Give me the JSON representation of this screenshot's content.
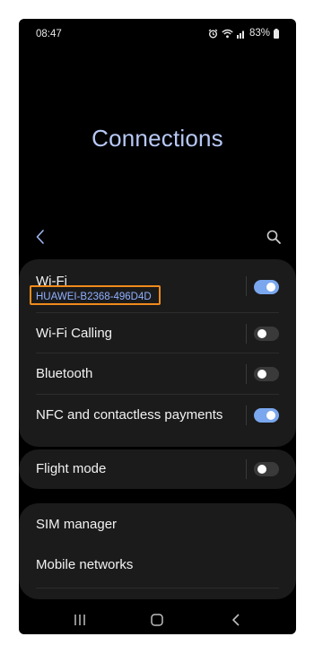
{
  "status": {
    "time": "08:47",
    "battery": "83%",
    "icons": [
      "alarm-icon",
      "wifi-icon",
      "signal-icon",
      "battery-icon"
    ]
  },
  "header": {
    "title": "Connections"
  },
  "sections": {
    "wifi": {
      "label": "Wi-Fi",
      "network": "HUAWEI-B2368-496D4D",
      "enabled": true
    },
    "wifi_calling": {
      "label": "Wi-Fi Calling",
      "enabled": false
    },
    "bluetooth": {
      "label": "Bluetooth",
      "enabled": false
    },
    "nfc": {
      "label": "NFC and contactless payments",
      "enabled": true
    },
    "flight_mode": {
      "label": "Flight mode",
      "enabled": false
    },
    "sim_manager": {
      "label": "SIM manager"
    },
    "mobile_networks": {
      "label": "Mobile networks"
    }
  },
  "colors": {
    "accent": "#7aa7ee",
    "title": "#b7c8f5",
    "highlight": "#f08a1c",
    "card": "#1b1b1b"
  },
  "nav": {
    "icons": [
      "recent-apps-icon",
      "home-icon",
      "back-icon"
    ]
  }
}
